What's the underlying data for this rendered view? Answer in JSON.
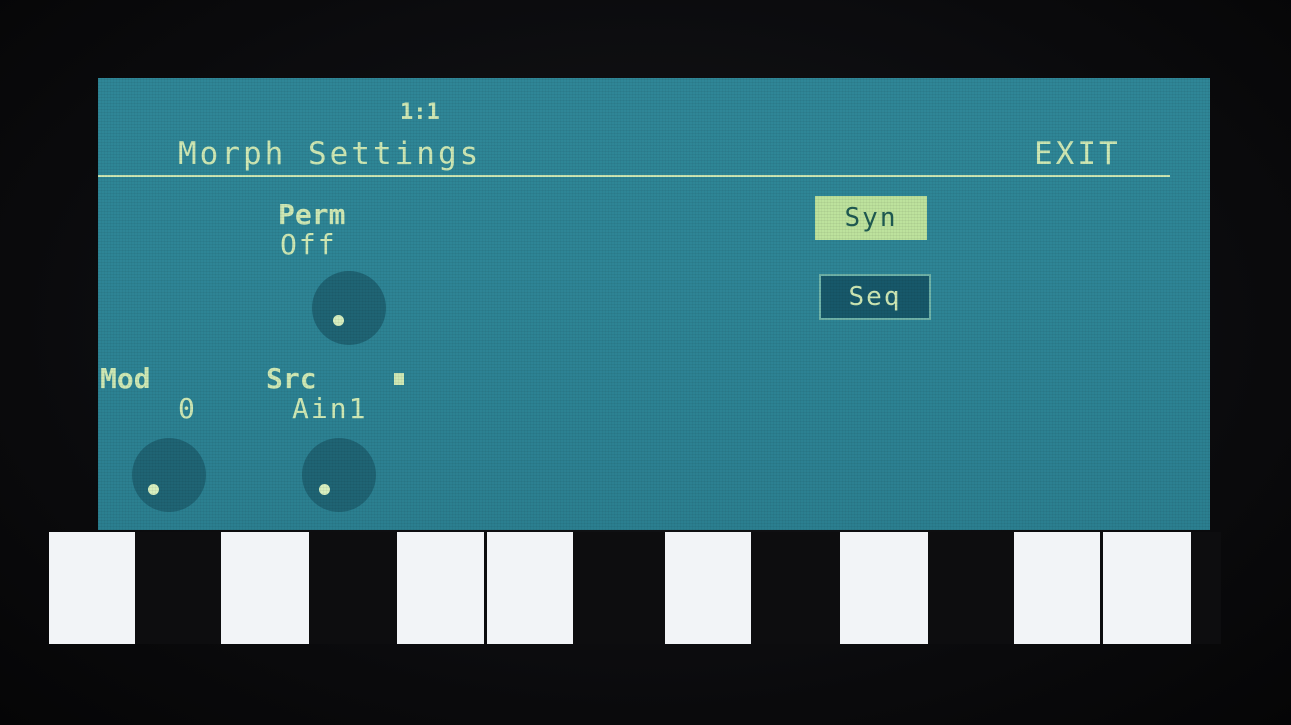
{
  "header": {
    "page_number": "1:1",
    "title": "Morph Settings",
    "exit_label": "EXIT"
  },
  "params": {
    "perm": {
      "label": "Perm",
      "value": "Off"
    },
    "mod": {
      "label": "Mod",
      "value": "0"
    },
    "src": {
      "label": "Src",
      "value": "Ain1"
    }
  },
  "buttons": {
    "syn": "Syn",
    "seq": "Seq"
  },
  "colors": {
    "screen": "#2f8697",
    "text": "#cfe9b5",
    "knob": "#1f6474",
    "selected_button": "#bde29d"
  }
}
